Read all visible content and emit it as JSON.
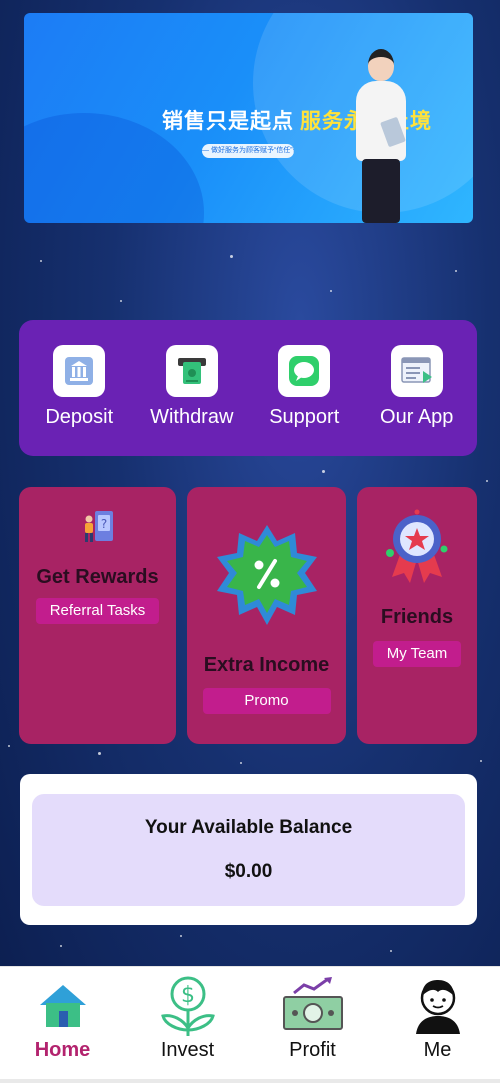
{
  "banner": {
    "headline": "销售只是起点",
    "headline_accent": "服务永无止境",
    "tagline": "— 做好服务为顾客赋予“信任”价值 —"
  },
  "quick_actions": [
    {
      "label": "Deposit",
      "icon": "bank-icon"
    },
    {
      "label": "Withdraw",
      "icon": "atm-withdraw-icon"
    },
    {
      "label": "Support",
      "icon": "chat-bubble-icon"
    },
    {
      "label": "Our App",
      "icon": "app-window-icon"
    }
  ],
  "cards": {
    "rewards": {
      "title": "Get Rewards",
      "button": "Referral Tasks",
      "icon": "referral-document-icon"
    },
    "income": {
      "title": "Extra Income",
      "button": "Promo",
      "icon": "discount-badge-icon"
    },
    "friends": {
      "title": "Friends",
      "button": "My Team",
      "icon": "award-ribbon-icon"
    }
  },
  "balance": {
    "title": "Your Available Balance",
    "amount": "$0.00"
  },
  "tabbar": [
    {
      "label": "Home",
      "icon": "home-icon",
      "active": true
    },
    {
      "label": "Invest",
      "icon": "money-plant-icon",
      "active": false
    },
    {
      "label": "Profit",
      "icon": "banknote-chart-icon",
      "active": false
    },
    {
      "label": "Me",
      "icon": "user-avatar-icon",
      "active": false
    }
  ],
  "colors": {
    "quick_panel": "#6a22b4",
    "card_bg": "#a82364",
    "card_pill": "#c21d8d",
    "balance_inner": "#e4dcfb",
    "tab_active": "#b3236e"
  }
}
